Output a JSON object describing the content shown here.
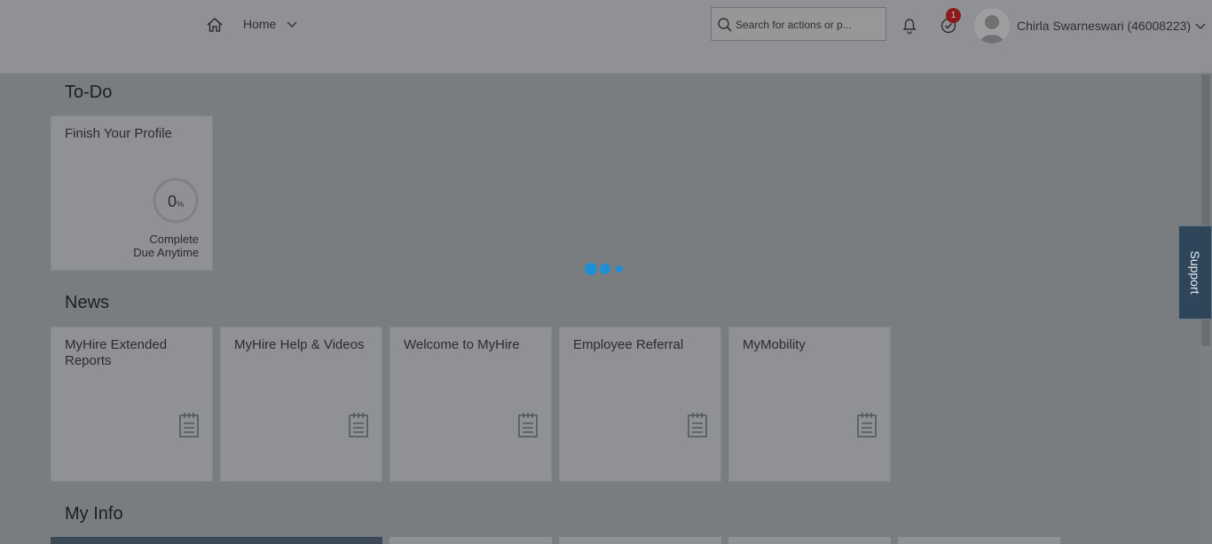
{
  "header": {
    "nav_label": "Home",
    "search_placeholder": "Search for actions or p...",
    "notification_count": "1",
    "user_name": "Chirla Swarneswari (46008223)"
  },
  "sections": {
    "todo_title": "To-Do",
    "news_title": "News",
    "myinfo_title": "My Info"
  },
  "todo_tile": {
    "title": "Finish Your Profile",
    "progress_number": "0",
    "progress_unit": "%",
    "status": "Complete",
    "due": "Due Anytime"
  },
  "news_tiles": [
    {
      "title": "MyHire Extended Reports"
    },
    {
      "title": "MyHire Help & Videos"
    },
    {
      "title": "Welcome to MyHire"
    },
    {
      "title": "Employee Referral"
    },
    {
      "title": "MyMobility"
    }
  ],
  "support_label": "Support",
  "icons": [
    "home-icon",
    "chevron-down-icon",
    "search-icon",
    "bell-icon",
    "todo-check-icon",
    "avatar",
    "document-icon",
    "busy-indicator"
  ]
}
